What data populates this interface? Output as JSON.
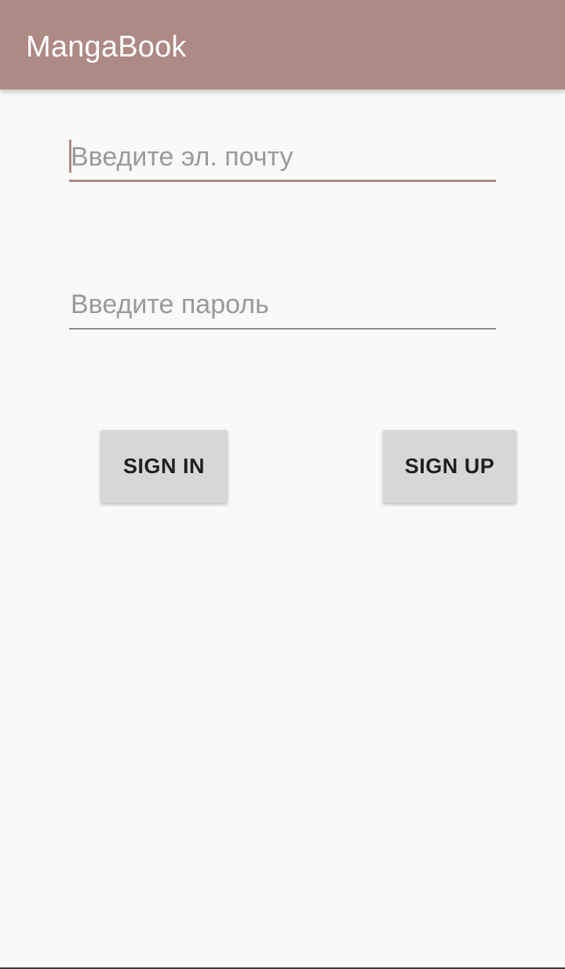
{
  "app_bar": {
    "title": "MangaBook",
    "color": "#ae8a85"
  },
  "form": {
    "email": {
      "value": "",
      "placeholder": "Введите эл. почту",
      "focused": true
    },
    "password": {
      "value": "",
      "placeholder": "Введите пароль",
      "focused": false
    }
  },
  "buttons": {
    "sign_in": "SIGN IN",
    "sign_up": "SIGN UP"
  }
}
